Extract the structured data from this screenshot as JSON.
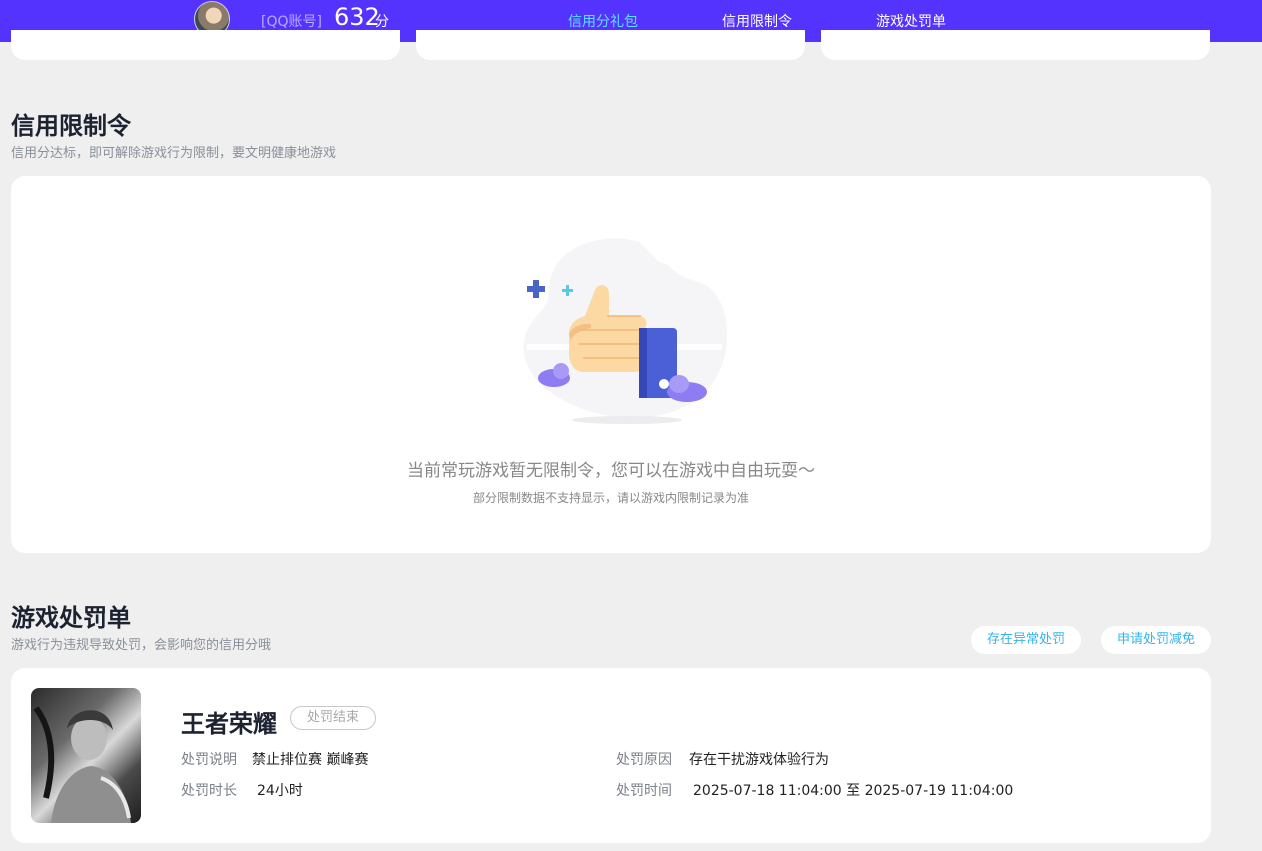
{
  "header": {
    "account_label": "[QQ账号]",
    "score_value": "632",
    "score_unit": "分",
    "tabs": [
      {
        "label": "信用分礼包",
        "active": true
      },
      {
        "label": "信用限制令",
        "active": false
      },
      {
        "label": "游戏处罚单",
        "active": false
      }
    ]
  },
  "restriction": {
    "title": "信用限制令",
    "subtitle": "信用分达标，即可解除游戏行为限制，要文明健康地游戏",
    "empty_message": "当前常玩游戏暂无限制令，您可以在游戏中自由玩耍～",
    "empty_note": "部分限制数据不支持显示，请以游戏内限制记录为准",
    "illustration_icon": "thumbs-up-icon"
  },
  "penalty": {
    "title": "游戏处罚单",
    "subtitle": "游戏行为违规导致处罚，会影响您的信用分哦",
    "actions": {
      "abnormal_label": "存在异常处罚",
      "appeal_label": "申请处罚减免"
    },
    "record": {
      "game_name": "王者荣耀",
      "status": "处罚结束",
      "desc_label": "处罚说明",
      "desc_value": "禁止排位赛 巅峰赛",
      "reason_label": "处罚原因",
      "reason_value": "存在干扰游戏体验行为",
      "duration_label": "处罚时长",
      "duration_value": "24小时",
      "time_label": "处罚时间",
      "time_value": "2025-07-18 11:04:00 至 2025-07-19 11:04:00"
    }
  },
  "colors": {
    "header_bg": "#5533ff",
    "active_tab": "#5fe2ff",
    "link": "#36b5e8"
  }
}
